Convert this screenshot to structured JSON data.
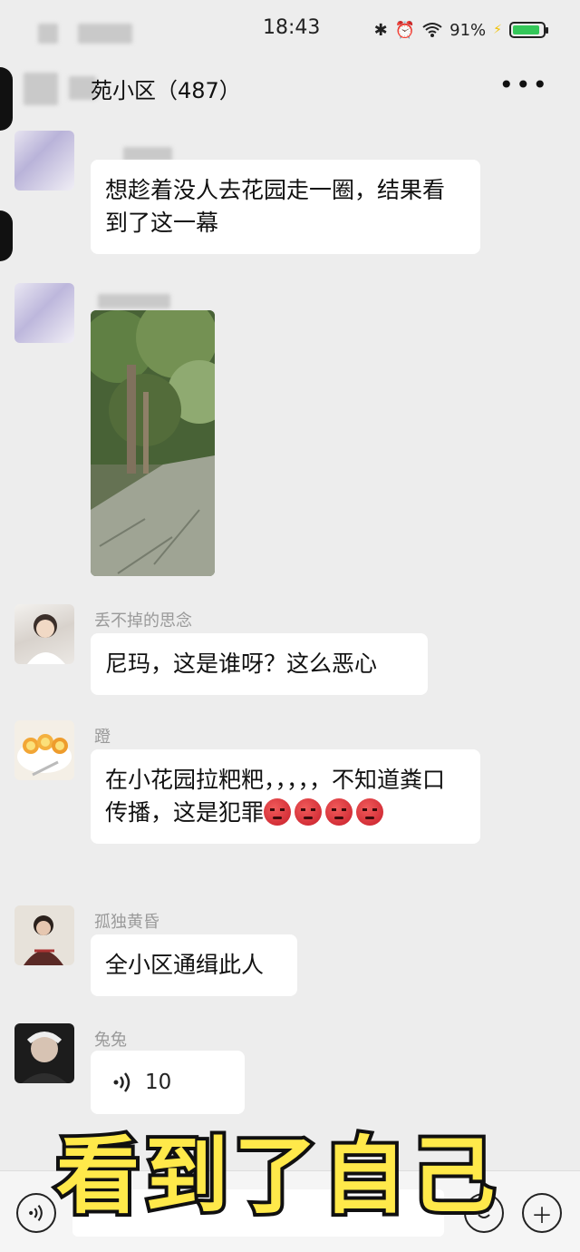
{
  "status_bar": {
    "time": "18:43",
    "bluetooth_icon": "bluetooth-icon",
    "alarm_icon": "alarm-icon",
    "wifi_icon": "wifi-icon",
    "battery_percent": "91%",
    "battery_level": 0.91
  },
  "header": {
    "title": "苑小区（487）",
    "more_icon": "more-dots-icon"
  },
  "messages": [
    {
      "sender": "",
      "text": "想趁着没人去花园走一圈，结果看到了这一幕"
    },
    {
      "sender": "",
      "type": "image"
    },
    {
      "sender": "丢不掉的思念",
      "text": "尼玛，这是谁呀？这么恶心"
    },
    {
      "sender": "蹬",
      "text": "在小花园拉粑粑，，，，，不知道粪口传播，这是犯罪"
    },
    {
      "sender": "孤独黄昏",
      "text": "全小区通缉此人"
    },
    {
      "sender": "兔兔",
      "type": "voice",
      "duration": "10"
    }
  ],
  "emoji": {
    "angry_name": "angry-face-icon",
    "count": 4
  },
  "caption": "看到了自己",
  "bottom_bar": {
    "voice_icon": "voice-input-icon",
    "emoji_icon": "emoji-icon",
    "plus_icon": "plus-icon"
  }
}
